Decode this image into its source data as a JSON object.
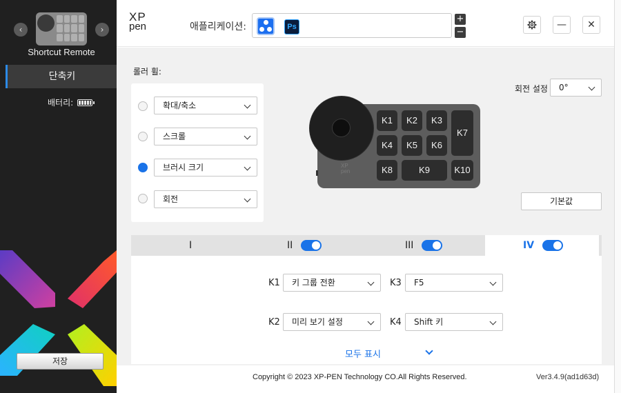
{
  "sidebar": {
    "device_name": "Shortcut Remote",
    "tab_label": "단축키",
    "battery_label": "배터리:",
    "battery_level": 1.0,
    "save_label": "저장",
    "prev_glyph": "‹",
    "next_glyph": "›"
  },
  "header": {
    "logo_line1": "XP",
    "logo_line2": "pen",
    "app_label": "애플리케이션:",
    "apps": [
      {
        "name": "all-apps-icon"
      },
      {
        "name": "photoshop-icon",
        "text": "Ps"
      }
    ],
    "plus": "+",
    "minus": "−",
    "settings_icon": "gear-icon",
    "minimize_glyph": "—",
    "close_glyph": "✕"
  },
  "roller": {
    "title": "롤러 휠:",
    "options": [
      {
        "label": "확대/축소",
        "selected": false
      },
      {
        "label": "스크롤",
        "selected": false
      },
      {
        "label": "브러시 크기",
        "selected": true
      },
      {
        "label": "회전",
        "selected": false
      }
    ]
  },
  "rotation": {
    "label": "회전 설정",
    "value": "0°"
  },
  "reset_label": "기본값",
  "device": {
    "brand_line1": "XP",
    "brand_line2": "pen",
    "keys": [
      "K1",
      "K2",
      "K3",
      "K4",
      "K5",
      "K6",
      "K7",
      "K8",
      "K9",
      "K10"
    ]
  },
  "tabs": [
    {
      "label": "I",
      "toggle": false,
      "active": false
    },
    {
      "label": "II",
      "toggle": true,
      "active": false
    },
    {
      "label": "III",
      "toggle": true,
      "active": false
    },
    {
      "label": "IV",
      "toggle": true,
      "active": true
    }
  ],
  "key_mappings": [
    {
      "key": "K1",
      "value": "키 그룹 전환"
    },
    {
      "key": "K3",
      "value": "F5"
    },
    {
      "key": "K2",
      "value": "미리 보기 설정"
    },
    {
      "key": "K4",
      "value": "Shift 키"
    }
  ],
  "show_all_label": "모두 표시",
  "footer": {
    "copyright": "Copyright © 2023  XP-PEN Technology CO.All Rights Reserved.",
    "version": "Ver3.4.9(ad1d63d)"
  }
}
